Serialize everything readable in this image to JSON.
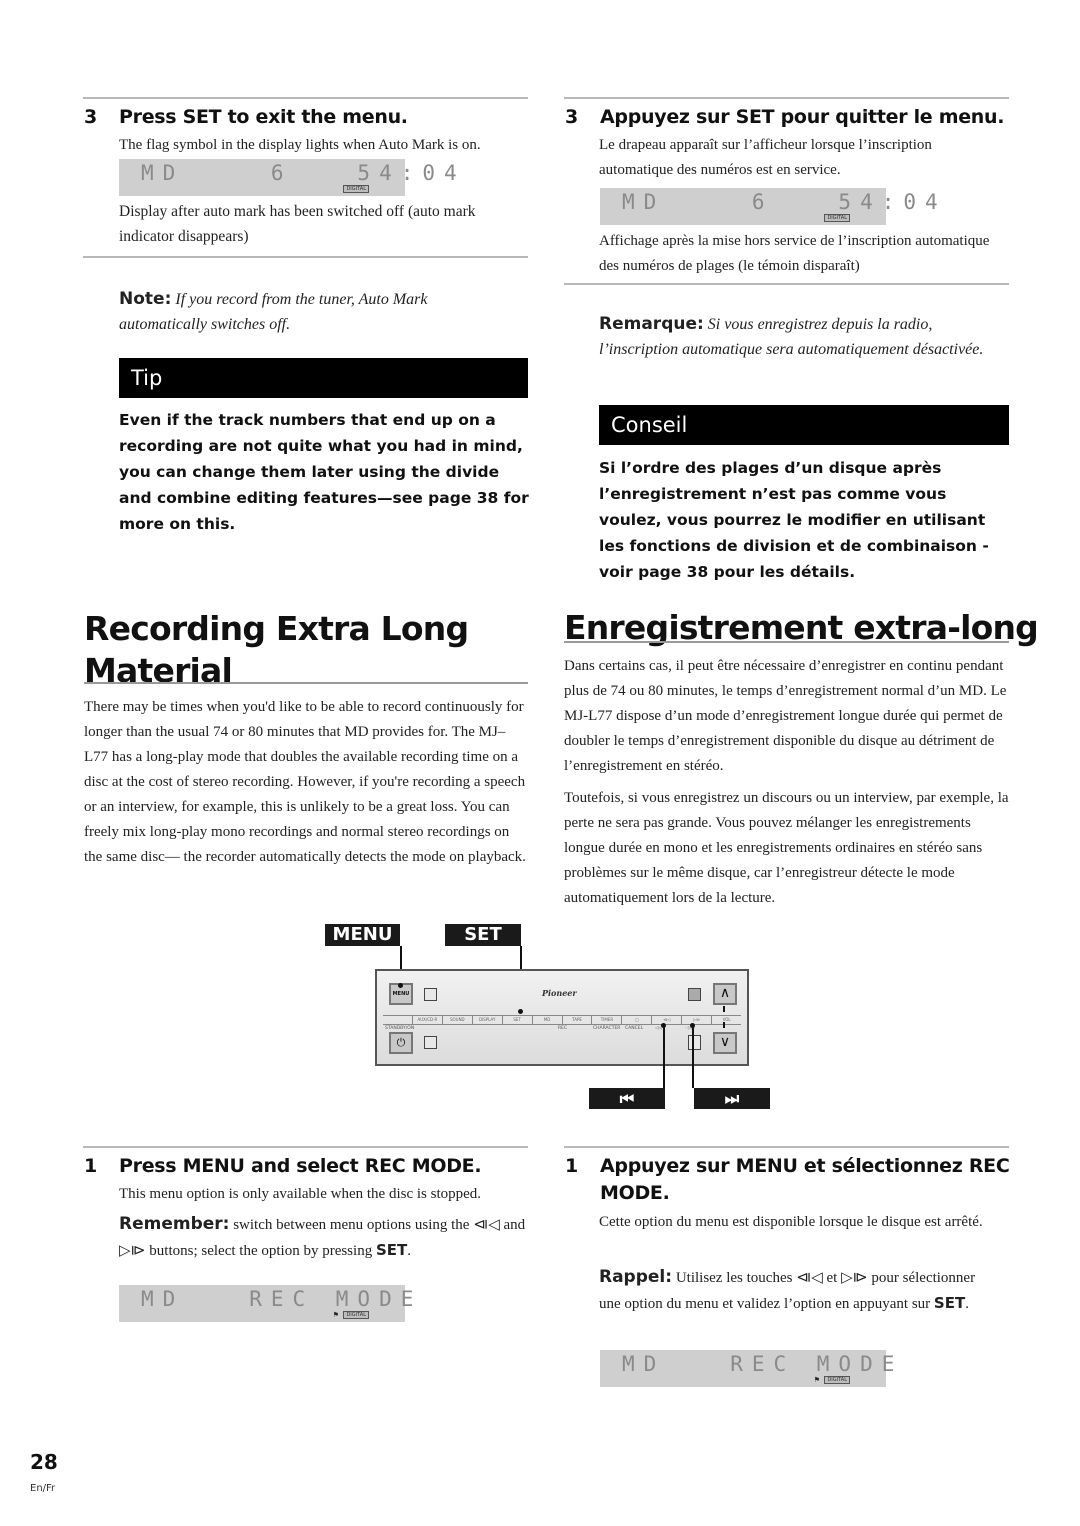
{
  "left_column": {
    "step3": {
      "number": "3",
      "title": "Press SET to exit the menu.",
      "desc": "The flag symbol in the display lights when Auto Mark is on.",
      "lcd": {
        "text": "MD    6   54:04",
        "badge": "DIGITAL"
      },
      "caption": "Display after auto mark has been switched off (auto mark indicator disappears)"
    },
    "note": {
      "label": "Note:",
      "text": "If you record from the tuner, Auto Mark automatically switches off."
    },
    "tip": {
      "title": "Tip",
      "body": "Even if the track numbers that end up on a recording are not quite what you had in mind, you can change them later using the divide and combine editing features—see page 38 for more on this."
    },
    "section": {
      "title_line1": "Recording Extra Long",
      "title_line2": "Material",
      "body": "There may be times when you'd like to be able to record continuously for longer than the usual 74 or 80 minutes that MD provides for. The MJ–L77 has a long-play mode that doubles the available recording time on a disc at the cost of stereo recording. However, if you're recording a speech or an interview, for example, this is unlikely to be a great loss. You can freely mix long-play mono recordings and normal stereo recordings on the same disc— the recorder automatically detects the mode on playback."
    },
    "step1": {
      "number": "1",
      "title": "Press MENU and select REC MODE.",
      "desc": "This menu option is only available when the disc is stopped.",
      "remember_label": "Remember:",
      "remember_text_a": "switch between menu options using the",
      "prev_symbol": "⧏◁",
      "and": "and",
      "next_symbol": "▷⧐",
      "remember_text_b": "buttons; select the option by pressing",
      "set": "SET",
      "period": ".",
      "lcd": {
        "text": "MD   REC MODE",
        "badge": "DIGITAL",
        "flag": "⚑"
      }
    }
  },
  "right_column": {
    "step3": {
      "number": "3",
      "title": "Appuyez sur SET pour quitter le menu.",
      "desc": "Le drapeau apparaît sur l’afficheur lorsque l’inscription automatique des numéros est en service.",
      "lcd": {
        "text": "MD    6   54:04",
        "badge": "DIGITAL"
      },
      "caption": "Affichage après la mise hors service de l’inscription automatique des numéros de plages (le témoin disparaît)"
    },
    "note": {
      "label": "Remarque:",
      "text": "Si vous enregistrez depuis la radio, l’inscription automatique sera automatiquement désactivée."
    },
    "tip": {
      "title": "Conseil",
      "body": "Si l’ordre des plages d’un disque après l’enregistrement n’est pas comme vous voulez, vous pourrez le modifier en utilisant les fonctions de division et de combinaison - voir page 38 pour les détails."
    },
    "section": {
      "title": "Enregistrement extra-long",
      "body1": "Dans certains cas, il peut être nécessaire d’enregistrer en continu pendant plus de 74 ou 80 minutes, le temps d’enregistrement normal d’un MD. Le MJ-L77 dispose d’un mode d’enregistrement longue durée qui permet de doubler le temps d’enregistrement disponible du disque au détriment de l’enregistrement en stéréo.",
      "body2": "Toutefois, si vous enregistrez un discours ou un interview, par exemple, la perte ne sera pas grande. Vous pouvez mélanger les enregistrements longue durée en mono et les enregistrements ordinaires en stéréo sans problèmes sur le même disque, car l’enregistreur détecte le mode automatiquement lors de la lecture."
    },
    "step1": {
      "number": "1",
      "title_line1": "Appuyez sur MENU et sélectionnez REC",
      "title_line2": "MODE.",
      "desc": "Cette option du menu est disponible lorsque le disque est arrêté.",
      "remember_label": "Rappel:",
      "remember_text_a": "Utilisez les touches",
      "prev_symbol": "⧏◁",
      "and": "et",
      "next_symbol": "▷⧐",
      "remember_text_b": "pour sélectionner une option du menu et validez l’option en appuyant sur",
      "set": "SET",
      "period": ".",
      "lcd": {
        "text": "MD   REC MODE",
        "badge": "DIGITAL",
        "flag": "⚑"
      }
    }
  },
  "diagram": {
    "callouts": {
      "menu": "MENU",
      "set": "SET",
      "prev": "⏮",
      "next": "⏭"
    },
    "panel": {
      "brand": "Pioneer",
      "menu_button": "MENU",
      "strip_labels": [
        "",
        "AUX/CD-R",
        "SOUND",
        "DISPLAY",
        "SET",
        "MD",
        "TAPE",
        "TIMER",
        "□",
        "⧏◁",
        "▷⧐",
        "VOL"
      ],
      "lower_labels": {
        "standby": "STANDBY/ON",
        "rec": "REC",
        "character": "CHARACTER",
        "cancel": "CANCEL",
        "prev": "◁◁ ·",
        "next": "· ▷▷"
      },
      "up_symbol": "∧",
      "down_symbol": "∨",
      "power_symbol": "⏻"
    }
  },
  "footer": {
    "page_number": "28",
    "language": "En/Fr"
  }
}
